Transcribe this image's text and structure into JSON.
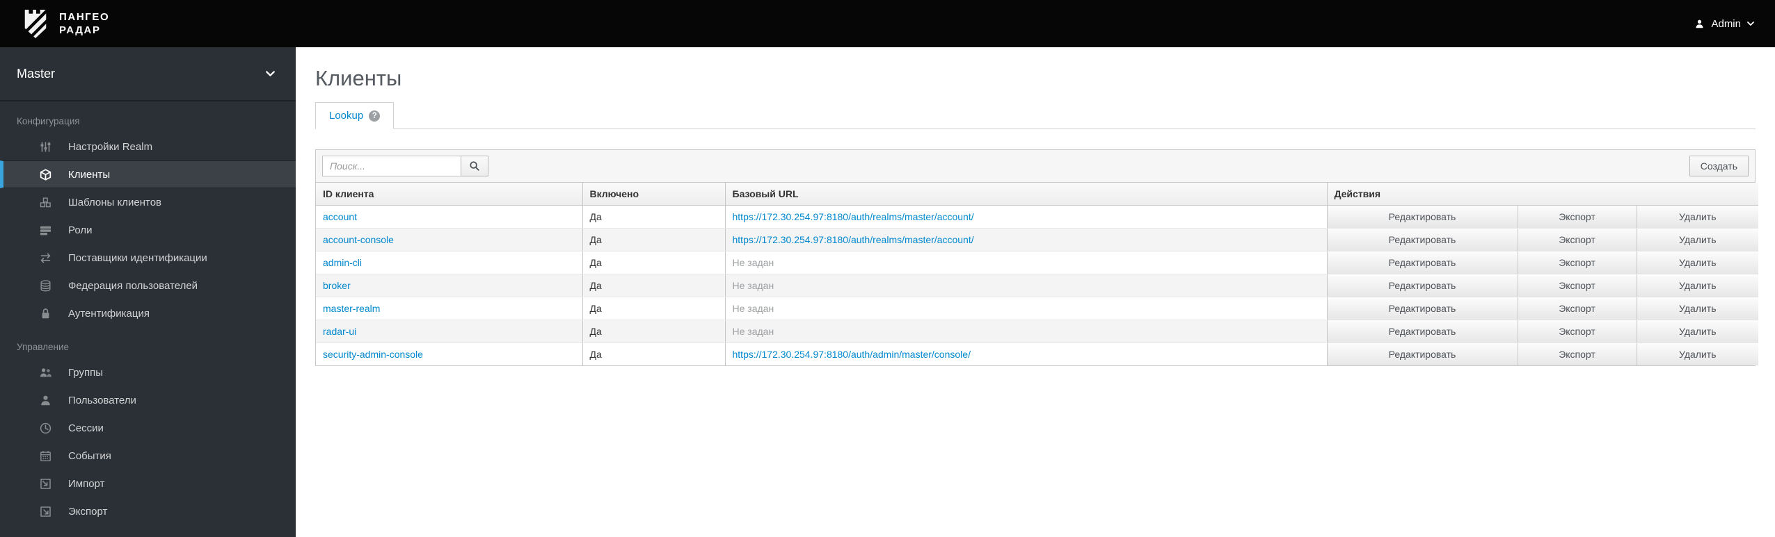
{
  "topbar": {
    "brand_line1": "ПАНГЕО",
    "brand_line2": "РАДАР",
    "user_label": "Admin"
  },
  "sidebar": {
    "realm": "Master",
    "sections": [
      {
        "label": "Конфигурация",
        "items": [
          {
            "icon": "sliders-icon",
            "label": "Настройки Realm",
            "active": false
          },
          {
            "icon": "cube-icon",
            "label": "Клиенты",
            "active": true
          },
          {
            "icon": "cubes-icon",
            "label": "Шаблоны клиентов",
            "active": false
          },
          {
            "icon": "roles-icon",
            "label": "Роли",
            "active": false
          },
          {
            "icon": "exchange-icon",
            "label": "Поставщики идентификации",
            "active": false
          },
          {
            "icon": "database-icon",
            "label": "Федерация пользователей",
            "active": false
          },
          {
            "icon": "lock-icon",
            "label": "Аутентификация",
            "active": false
          }
        ]
      },
      {
        "label": "Управление",
        "items": [
          {
            "icon": "groups-icon",
            "label": "Группы",
            "active": false
          },
          {
            "icon": "user-icon",
            "label": "Пользователи",
            "active": false
          },
          {
            "icon": "clock-icon",
            "label": "Сессии",
            "active": false
          },
          {
            "icon": "calendar-icon",
            "label": "События",
            "active": false
          },
          {
            "icon": "import-icon",
            "label": "Импорт",
            "active": false
          },
          {
            "icon": "export-icon",
            "label": "Экспорт",
            "active": false
          }
        ]
      }
    ]
  },
  "main": {
    "title": "Клиенты",
    "tab_label": "Lookup",
    "tab_help": "?",
    "search_placeholder": "Поиск...",
    "create_label": "Создать",
    "table": {
      "headers": [
        "ID клиента",
        "Включено",
        "Базовый URL",
        "Действия"
      ],
      "empty_url_text": "Не задан",
      "action_labels": [
        "Редактировать",
        "Экспорт",
        "Удалить"
      ],
      "rows": [
        {
          "id": "account",
          "enabled": "Да",
          "url": "https://172.30.254.97:8180/auth/realms/master/account/",
          "has_url": true
        },
        {
          "id": "account-console",
          "enabled": "Да",
          "url": "https://172.30.254.97:8180/auth/realms/master/account/",
          "has_url": true
        },
        {
          "id": "admin-cli",
          "enabled": "Да",
          "url": "Не задан",
          "has_url": false
        },
        {
          "id": "broker",
          "enabled": "Да",
          "url": "Не задан",
          "has_url": false
        },
        {
          "id": "master-realm",
          "enabled": "Да",
          "url": "Не задан",
          "has_url": false
        },
        {
          "id": "radar-ui",
          "enabled": "Да",
          "url": "Не задан",
          "has_url": false
        },
        {
          "id": "security-admin-console",
          "enabled": "Да",
          "url": "https://172.30.254.97:8180/auth/admin/master/console/",
          "has_url": true
        }
      ]
    }
  },
  "colors": {
    "link_blue": "#0088ce",
    "active_nav_bar": "#39a5dc",
    "sidebar_bg": "#2b3036",
    "topbar_bg": "#060606"
  }
}
